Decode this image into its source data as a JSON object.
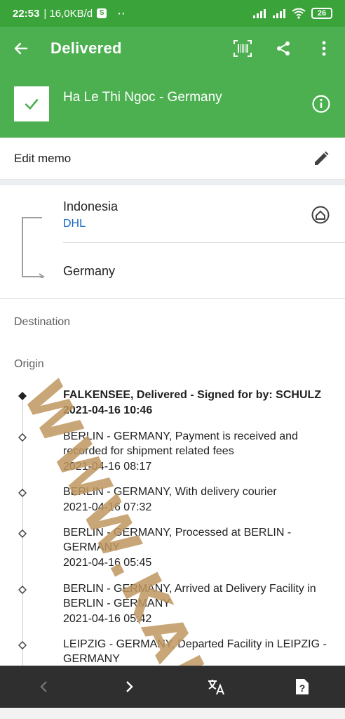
{
  "status_bar": {
    "time": "22:53",
    "speed": "| 16,0KB/d",
    "dots": "··",
    "battery": "26"
  },
  "app_bar": {
    "title": "Delivered"
  },
  "header": {
    "recipient": "Ha Le Thi Ngoc - Germany"
  },
  "memo": {
    "label": "Edit memo"
  },
  "route": {
    "origin_country": "Indonesia",
    "carrier": "DHL",
    "destination_country": "Germany"
  },
  "sections": {
    "destination": "Destination",
    "origin": "Origin"
  },
  "events": [
    {
      "desc": "FALKENSEE, Delivered - Signed for by: SCHULZ",
      "time": "2021-04-16 10:46"
    },
    {
      "desc": "BERLIN - GERMANY, Payment is received and recorded for shipment related fees",
      "time": "2021-04-16 08:17"
    },
    {
      "desc": "BERLIN - GERMANY, With delivery courier",
      "time": "2021-04-16 07:32"
    },
    {
      "desc": "BERLIN - GERMANY, Processed at BERLIN - GERMANY",
      "time": "2021-04-16 05:45"
    },
    {
      "desc": "BERLIN - GERMANY, Arrived at Delivery Facility in BERLIN - GERMANY",
      "time": "2021-04-16 05:42"
    },
    {
      "desc": "LEIPZIG - GERMANY, Departed Facility in LEIPZIG - GERMANY",
      "time": ""
    }
  ],
  "watermark": "WWW.KAKTUS.ID",
  "colors": {
    "primary": "#4caf50",
    "status_bar": "#3aa33a",
    "link": "#1565c0",
    "bottom_nav": "#2f2f2f"
  },
  "icons": {
    "back": "arrow-left",
    "barcode": "barcode-scan",
    "share": "share",
    "more": "more-vertical",
    "check": "check",
    "info": "info-circle",
    "edit": "pencil",
    "home": "home-circle",
    "prev": "chevron-left",
    "next": "chevron-right",
    "translate": "translate",
    "help": "help-square"
  }
}
